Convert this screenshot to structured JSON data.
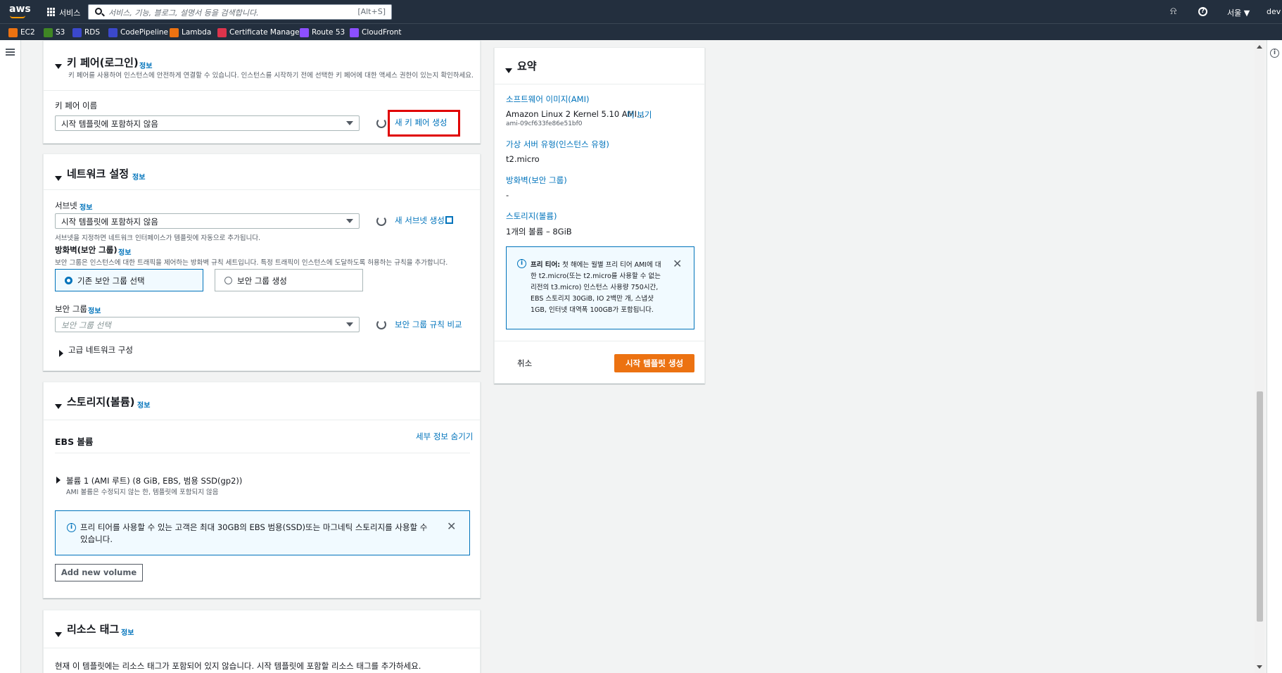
{
  "topbar": {
    "logo": "aws",
    "services": "서비스",
    "search_placeholder": "서비스, 기능, 블로그, 설명서 등을 검색합니다.",
    "search_shortcut": "[Alt+S]",
    "region": "서울 ▼",
    "account": "dev"
  },
  "favorites": [
    {
      "label": "EC2",
      "color": "#ec7211"
    },
    {
      "label": "S3",
      "color": "#3f8624"
    },
    {
      "label": "RDS",
      "color": "#3b48cc"
    },
    {
      "label": "CodePipeline",
      "color": "#3b48cc"
    },
    {
      "label": "Lambda",
      "color": "#ec7211"
    },
    {
      "label": "Certificate Manager",
      "color": "#dd344c"
    },
    {
      "label": "Route 53",
      "color": "#8c4fff"
    },
    {
      "label": "CloudFront",
      "color": "#8c4fff"
    }
  ],
  "keypair": {
    "title": "키 페어(로그인)",
    "info": "정보",
    "desc": "키 페어를 사용하여 인스턴스에 안전하게 연결할 수 있습니다. 인스턴스를 시작하기 전에 선택한 키 페어에 대한 액세스 권한이 있는지 확인하세요.",
    "label": "키 페어 이름",
    "selected": "시작 템플릿에 포함하지 않음",
    "create": "새 키 페어 생성"
  },
  "network": {
    "title": "네트워크 설정",
    "info": "정보",
    "subnet_label": "서브넷",
    "subnet_info": "정보",
    "subnet_selected": "시작 템플릿에 포함하지 않음",
    "subnet_create": "새 서브넷 생성",
    "subnet_hint": "서브넷을 지정하면 네트워크 인터페이스가 템플릿에 자동으로 추가됩니다.",
    "firewall_label": "방화벽(보안 그룹)",
    "firewall_info": "정보",
    "firewall_desc": "보안 그룹은 인스턴스에 대한 트래픽을 제어하는 방화벽 규칙 세트입니다. 특정 트래픽이 인스턴스에 도달하도록 허용하는 규칙을 추가합니다.",
    "option_existing": "기존 보안 그룹 선택",
    "option_create": "보안 그룹 생성",
    "sg_label": "보안 그룹",
    "sg_info": "정보",
    "sg_placeholder": "보안 그룹 선택",
    "sg_compare": "보안 그룹 규칙 비교",
    "advanced": "고급 네트워크 구성"
  },
  "storage": {
    "title": "스토리지(볼륨)",
    "info": "정보",
    "ebs": "EBS 볼륨",
    "hide": "세부 정보 숨기기",
    "volume": "볼륨 1 (AMI 루트) (8 GiB, EBS, 범용 SSD(gp2))",
    "volume_note": "AMI 볼륨은 수정되지 않는 한, 템플릿에 포함되지 않음",
    "alert": "프리 티어를 사용할 수 있는 고객은 최대 30GB의 EBS 범용(SSD)또는 마그네틱 스토리지를 사용할 수 있습니다.",
    "add": "Add new volume"
  },
  "tags": {
    "title": "리소스 태그",
    "info": "정보",
    "desc": "현재 이 템플릿에는 리소스 태그가 포함되어 있지 않습니다. 시작 템플릿에 포함할 리소스 태그를 추가하세요."
  },
  "summary": {
    "title": "요약",
    "ami_label": "소프트웨어 이미지(AMI)",
    "ami_value": "Amazon Linux 2 Kernel 5.10 AMI...",
    "ami_more": "더 보기",
    "ami_id": "ami-09cf633fe86e51bf0",
    "type_label": "가상 서버 유형(인스턴스 유형)",
    "type_value": "t2.micro",
    "fw_label": "방화벽(보안 그룹)",
    "fw_value": "-",
    "storage_label": "스토리지(볼륨)",
    "storage_value": "1개의 볼륨 – 8GiB",
    "freetier_bold": "프리 티어:",
    "freetier_text": "첫 해에는 월별 프리 티어 AMI에 대한 t2.micro(또는 t2.micro를 사용할 수 없는 리전의 t3.micro) 인스턴스 사용량 750시간, EBS 스토리지 30GiB, IO 2백만 개, 스냅샷 1GB, 인터넷 대역폭 100GB가 포함됩니다.",
    "cancel": "취소",
    "create": "시작 템플릿 생성"
  }
}
